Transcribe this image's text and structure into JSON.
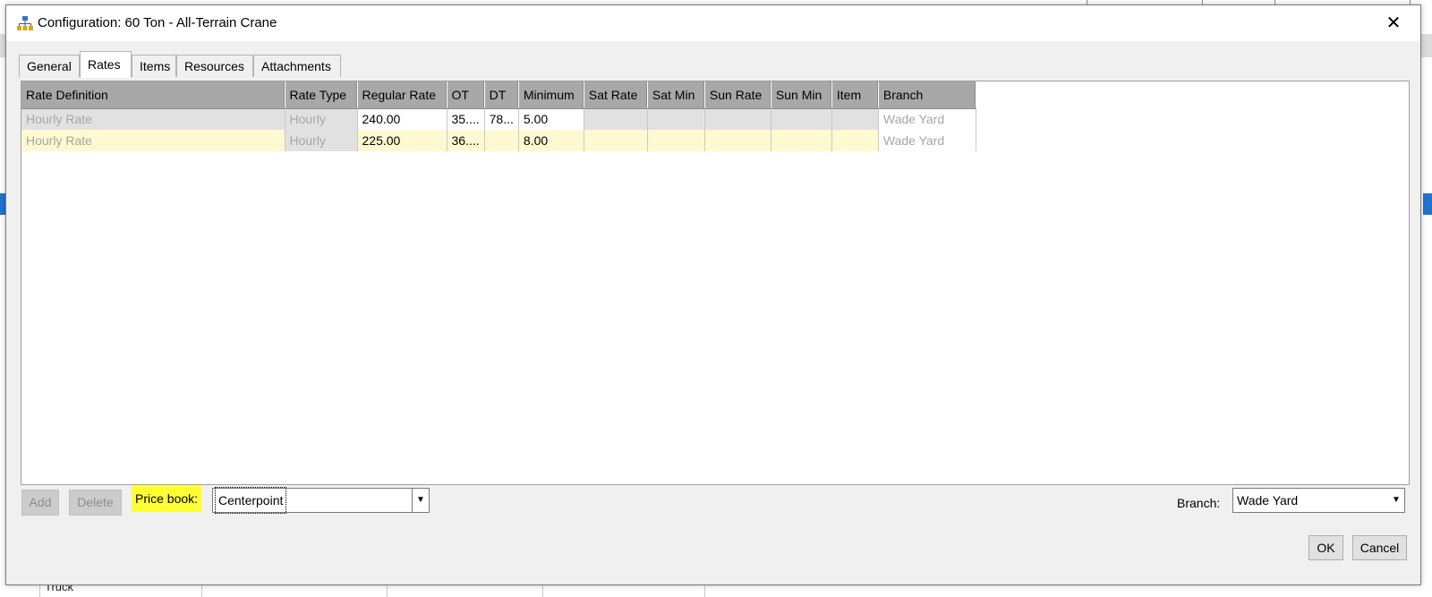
{
  "background": {
    "fragment_text": "Truck"
  },
  "dialog": {
    "title": "Configuration: 60 Ton - All-Terrain Crane",
    "title_icon": "hierarchy-icon",
    "close_glyph": "✕"
  },
  "tabs": [
    {
      "label": "General",
      "active": false
    },
    {
      "label": "Rates",
      "active": true
    },
    {
      "label": "Items",
      "active": false
    },
    {
      "label": "Resources",
      "active": false
    },
    {
      "label": "Attachments",
      "active": false
    }
  ],
  "grid": {
    "columns": [
      "Rate Definition",
      "Rate Type",
      "Regular Rate",
      "OT",
      "DT",
      "Minimum",
      "Sat Rate",
      "Sat Min",
      "Sun Rate",
      "Sun Min",
      "Item",
      "Branch"
    ],
    "rows": [
      [
        "Hourly Rate",
        "Hourly",
        "240.00",
        "35....",
        "78...",
        "5.00",
        "",
        "",
        "",
        "",
        "",
        "Wade Yard"
      ],
      [
        "Hourly Rate",
        "Hourly",
        "225.00",
        "36....",
        "",
        "8.00",
        "",
        "",
        "",
        "",
        "",
        "Wade Yard"
      ]
    ]
  },
  "controls": {
    "add_label": "Add",
    "delete_label": "Delete",
    "price_book_label": "Price book:",
    "price_book_value": "Centerpoint",
    "branch_label": "Branch:",
    "branch_value": "Wade Yard"
  },
  "footer": {
    "ok_label": "OK",
    "cancel_label": "Cancel"
  },
  "colors": {
    "highlight": "#ffff33",
    "row_selected": "#fff9d2",
    "header_bg": "#a8a8a8"
  }
}
